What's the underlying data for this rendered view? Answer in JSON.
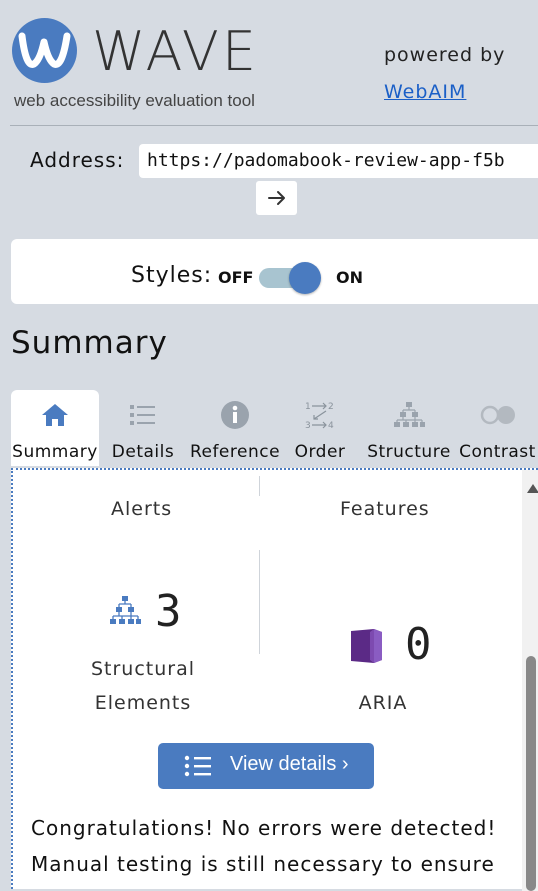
{
  "header": {
    "logo_text": "WAVE",
    "tagline": "web accessibility evaluation tool",
    "powered_by": "powered by",
    "webaim_link": "WebAIM"
  },
  "address": {
    "label": "Address:",
    "value": "https://padomabook-review-app-f5b"
  },
  "styles": {
    "label": "Styles:",
    "off": "OFF",
    "on": "ON",
    "state": "on"
  },
  "section_title": "Summary",
  "tabs": [
    {
      "label": "Summary",
      "icon": "home-icon",
      "active": true
    },
    {
      "label": "Details",
      "icon": "list-icon",
      "active": false
    },
    {
      "label": "Reference",
      "icon": "info-icon",
      "active": false
    },
    {
      "label": "Order",
      "icon": "order-icon",
      "active": false
    },
    {
      "label": "Structure",
      "icon": "structure-icon",
      "active": false
    },
    {
      "label": "Contrast",
      "icon": "contrast-icon",
      "active": false
    }
  ],
  "summary": {
    "alerts_heading": "Alerts",
    "features_heading": "Features",
    "structural": {
      "count": "3",
      "label_line1": "Structural",
      "label_line2": "Elements"
    },
    "aria": {
      "count": "0",
      "label": "ARIA"
    },
    "view_details": "View details ›",
    "message_line1": "Congratulations! No errors were detected!",
    "message_line2": "Manual testing is still necessary to ensure"
  },
  "colors": {
    "accent": "#4a7bc0",
    "aria_purple": "#5b2a86",
    "background": "#d6dbe2"
  }
}
